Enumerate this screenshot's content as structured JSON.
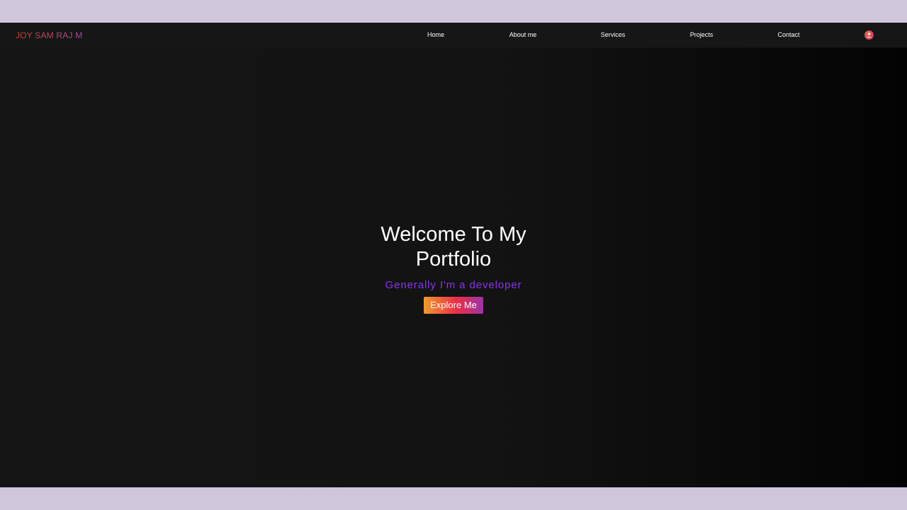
{
  "navbar": {
    "brand": "JOY SAM RAJ M",
    "links": [
      {
        "label": "Home"
      },
      {
        "label": "About me"
      },
      {
        "label": "Services"
      },
      {
        "label": "Projects"
      },
      {
        "label": "Contact"
      }
    ],
    "avatar_icon": "user-avatar-icon"
  },
  "hero": {
    "title_line1": "Welcome To My",
    "title_line2": "Portfolio",
    "subtitle": "Generally I'm a developer",
    "button_label": "Explore Me"
  },
  "colors": {
    "background": "#131313",
    "navbar": "#161616",
    "brand_gradient_start": "#c8432c",
    "brand_gradient_end": "#a64a9b",
    "subtitle": "#8a34f0",
    "button_gradient": [
      "#f29a2e",
      "#ee2d45",
      "#9b35a8"
    ],
    "frame": "#d0c6dc"
  }
}
